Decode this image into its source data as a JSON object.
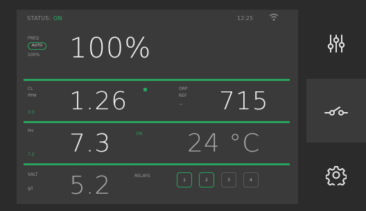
{
  "status": {
    "label": "STATUS:",
    "value": "ON",
    "time": "12:25",
    "wifi_icon": "wifi-icon"
  },
  "free": {
    "label": "FREQ",
    "mode": "AUTO",
    "sub": "100%",
    "value": "100%"
  },
  "cl": {
    "label": "CL",
    "sub": "PPM",
    "setpoint": "3.0",
    "value": "1.26"
  },
  "orp": {
    "label": "ORP",
    "sub": "REF",
    "sub2": "—",
    "value": "715"
  },
  "ph": {
    "label": "PH",
    "setpoint": "7.2",
    "value": "7.3",
    "indicator": "ON"
  },
  "temp": {
    "value": "24 °C"
  },
  "salt": {
    "label": "SALT",
    "sub": "g/l",
    "value": "5.2"
  },
  "relays": {
    "label": "RELAYS",
    "items": [
      "1",
      "2",
      "3",
      "4"
    ],
    "active": [
      true,
      true,
      false,
      false
    ]
  },
  "side": {
    "items": [
      "sliders-icon",
      "switch-icon",
      "gear-icon"
    ]
  },
  "colors": {
    "accent": "#2aa35e",
    "panel": "#3a3a3a",
    "background": "#2b2b2b"
  }
}
